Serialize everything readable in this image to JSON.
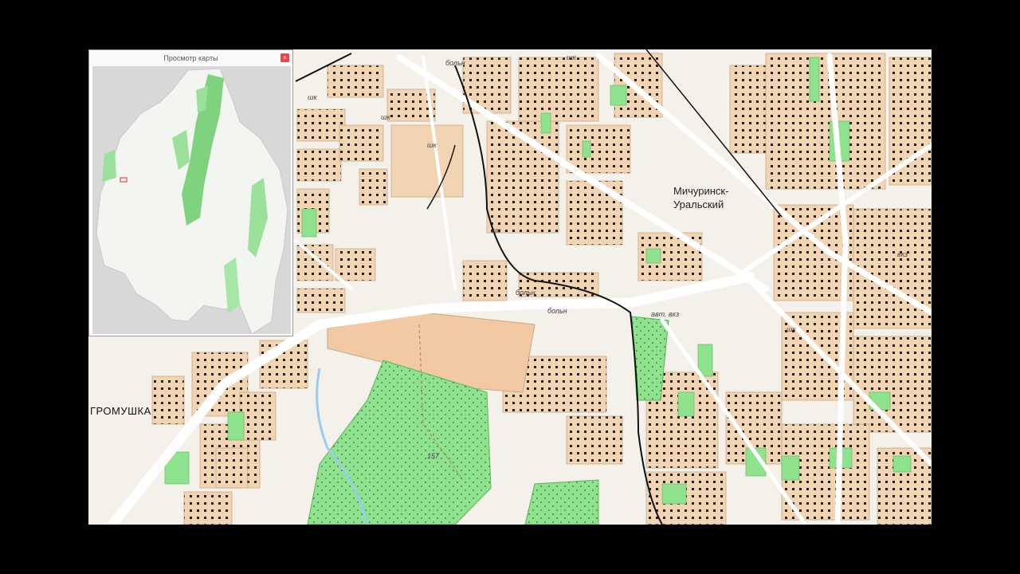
{
  "overview": {
    "title": "Просмотр карты",
    "close_glyph": "×"
  },
  "labels": {
    "station_line1": "Мичуринск-",
    "station_line2": "Уральский",
    "district": "ГРОМУШКА",
    "hospital_1": "больн",
    "hospital_2": "больн",
    "hospital_3": "больн",
    "bus_station": "авт. вкз",
    "station_abbr": "вкз",
    "school_1": "шк",
    "school_2": "шк",
    "school_3": "шк",
    "school_4": "шк",
    "school_5": "шк",
    "school_6": "шк",
    "elevation": "157"
  },
  "colors": {
    "block": "#f2d4b3",
    "block_edge": "#c9a886",
    "park": "#8fe38f",
    "park_light": "#b8f0b0",
    "road": "#ffffff",
    "railway": "#111111",
    "background": "#f4f1ea",
    "overview_land": "#f3f5f1",
    "overview_outside": "#d8d8d8",
    "overview_forest": "#7fd37f"
  }
}
